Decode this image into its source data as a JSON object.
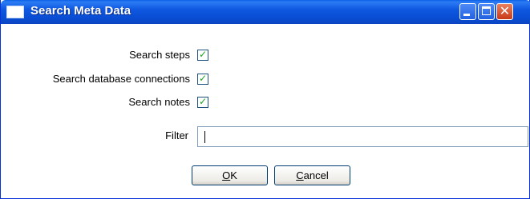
{
  "window": {
    "title": "Search Meta Data"
  },
  "options": {
    "search_steps": {
      "label": "Search steps",
      "checked": true
    },
    "search_db_connections": {
      "label": "Search database connections",
      "checked": true
    },
    "search_notes": {
      "label": "Search notes",
      "checked": true
    }
  },
  "filter": {
    "label": "Filter",
    "value": ""
  },
  "buttons": {
    "ok_mnemonic": "O",
    "ok_rest": "K",
    "cancel_mnemonic": "C",
    "cancel_rest": "ancel"
  },
  "colors": {
    "titlebar": "#0a4fd6",
    "checkmark": "#21a121",
    "close_button": "#c83a18"
  }
}
